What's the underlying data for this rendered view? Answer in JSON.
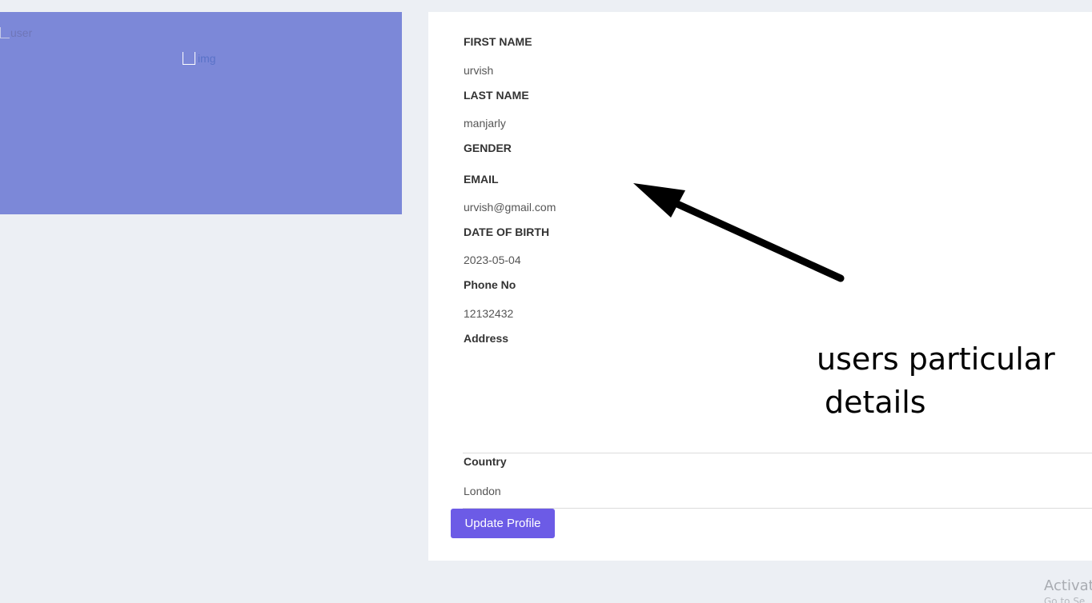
{
  "left_panel": {
    "broken_image_alt_user": "user",
    "broken_image_alt_main": "img"
  },
  "profile": {
    "first_name_label": "FIRST NAME",
    "first_name_value": "urvish",
    "last_name_label": "LAST NAME",
    "last_name_value": "manjarly",
    "gender_label": "GENDER",
    "email_label": "EMAIL",
    "email_value": "urvish@gmail.com",
    "dob_label": "DATE OF BIRTH",
    "dob_value": "2023-05-04",
    "phone_label": "Phone No",
    "phone_value": "12132432",
    "address_label": "Address",
    "country_label": "Country",
    "country_value": "London",
    "update_button": "Update Profile"
  },
  "annotation": {
    "line1": "users particular",
    "line2": "details"
  },
  "watermark": {
    "text": "Activat",
    "subtext": "Go to Se"
  },
  "colors": {
    "left_card": "#7c88d8",
    "button": "#6c5be6",
    "background": "#eceff4"
  }
}
